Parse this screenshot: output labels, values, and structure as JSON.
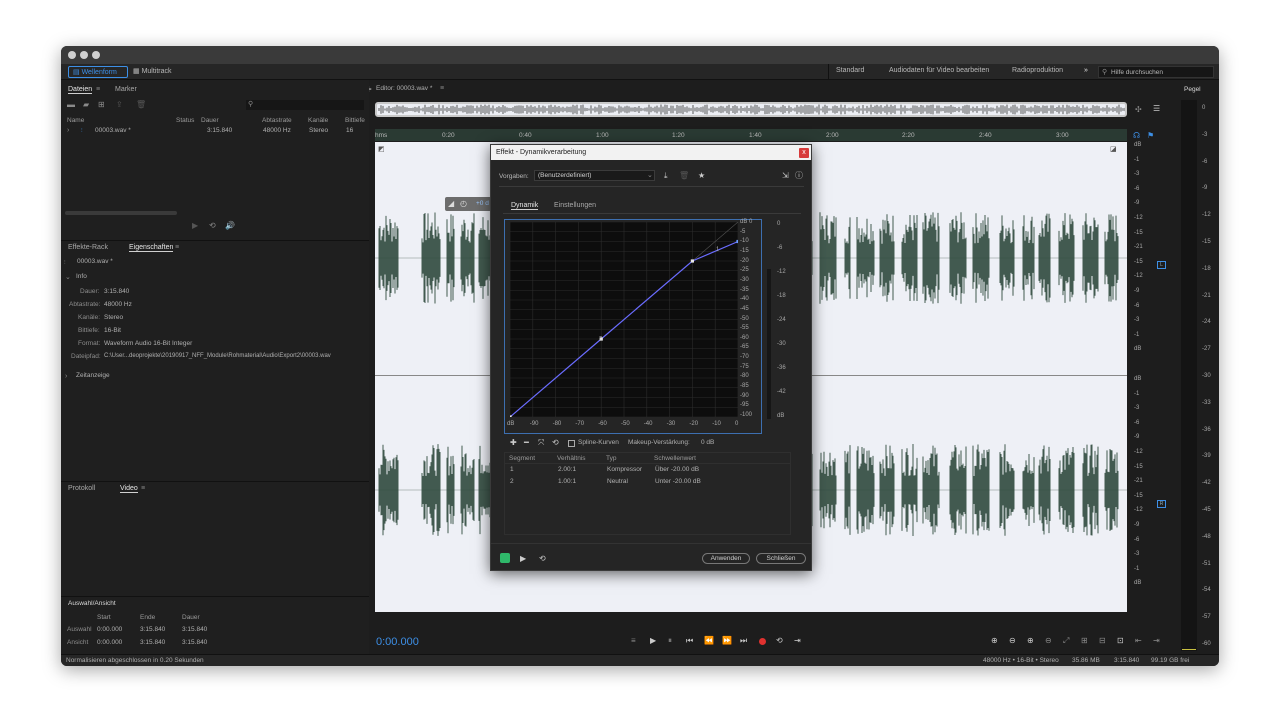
{
  "toolbar": {
    "waveform_label": "Wellenform",
    "multitrack_label": "Multitrack",
    "workspaces": [
      "Standard",
      "Audiodaten für Video bearbeiten",
      "Radioproduktion"
    ],
    "more_label": "»",
    "search_placeholder": "Hilfe durchsuchen"
  },
  "files_panel": {
    "tabs": [
      "Dateien",
      "Marker"
    ],
    "columns": [
      "Name",
      "Status",
      "Dauer",
      "Abtastrate",
      "Kanäle",
      "Bittiefe"
    ],
    "rows": [
      {
        "name": "00003.wav *",
        "status": "",
        "duration": "3:15.840",
        "rate": "48000 Hz",
        "channels": "Stereo",
        "depth": "16"
      }
    ]
  },
  "properties_panel": {
    "tabs": [
      "Effekte-Rack",
      "Eigenschaften"
    ],
    "file_name": "00003.wav *",
    "info_label": "Info",
    "info": [
      {
        "label": "Dauer:",
        "value": "3:15.840"
      },
      {
        "label": "Abtastrate:",
        "value": "48000 Hz"
      },
      {
        "label": "Kanäle:",
        "value": "Stereo"
      },
      {
        "label": "Bittiefe:",
        "value": "16-Bit"
      },
      {
        "label": "Format:",
        "value": "Waveform Audio 16-Bit Integer"
      },
      {
        "label": "Dateipfad:",
        "value": "C:\\User...deoprojekte\\20190917_NFF_Module\\Rohmaterial\\Audio\\Export2\\00003.wav"
      }
    ],
    "timecode_label": "Zeitanzeige"
  },
  "bottom_tabs": [
    "Protokoll",
    "Video"
  ],
  "selection_panel": {
    "title": "Auswahl/Ansicht",
    "columns": [
      "Start",
      "Ende",
      "Dauer"
    ],
    "rows": [
      {
        "label": "Auswahl",
        "start": "0:00.000",
        "end": "3:15.840",
        "dur": "3:15.840"
      },
      {
        "label": "Ansicht",
        "start": "0:00.000",
        "end": "3:15.840",
        "dur": "3:15.840"
      }
    ]
  },
  "editor": {
    "title": "Editor: 00003.wav *",
    "ruler": [
      "hms",
      "0:20",
      "0:40",
      "1:00",
      "1:20",
      "1:40",
      "2:00",
      "2:20",
      "2:40",
      "3:00"
    ],
    "db_scale": [
      "dB",
      "-1",
      "-3",
      "-6",
      "-9",
      "-12",
      "-15",
      "-21",
      "-15",
      "-12",
      "-9",
      "-6",
      "-3",
      "-1",
      "dB"
    ],
    "channel_l": "L",
    "channel_r": "R",
    "time_display": "0:00.000",
    "hud_value": "+0 d"
  },
  "level_panel": {
    "title": "Pegel",
    "scale": [
      "0",
      "-3",
      "-6",
      "-9",
      "-12",
      "-15",
      "-18",
      "-21",
      "-24",
      "-27",
      "-30",
      "-33",
      "-36",
      "-39",
      "-42",
      "-45",
      "-48",
      "-51",
      "-54",
      "-57",
      "-60"
    ]
  },
  "dialog": {
    "title": "Effekt - Dynamikverarbeitung",
    "close_label": "x",
    "preset_label": "Vorgaben:",
    "preset_value": "(Benutzerdefiniert)",
    "tabs": [
      "Dynamik",
      "Einstellungen"
    ],
    "graph_y_labels": [
      "dB 0",
      "-5",
      "-10",
      "-15",
      "-20",
      "-25",
      "-30",
      "-35",
      "-40",
      "-45",
      "-50",
      "-55",
      "-60",
      "-65",
      "-70",
      "-75",
      "-80",
      "-85",
      "-90",
      "-95",
      "-100"
    ],
    "graph_x_labels": [
      "dB",
      "-90",
      "-80",
      "-70",
      "-60",
      "-50",
      "-40",
      "-30",
      "-20",
      "-10",
      "0"
    ],
    "meter_labels": [
      "0",
      "-6",
      "-12",
      "-18",
      "-24",
      "-30",
      "-36",
      "-42",
      "dB"
    ],
    "point_labels": [
      "1",
      "2"
    ],
    "spline_label": "Spline-Kurven",
    "makeup_label": "Makeup-Verstärkung:",
    "makeup_value": "0 dB",
    "table_columns": [
      "Segment",
      "Verhältnis",
      "Typ",
      "Schwellenwert"
    ],
    "segments": [
      {
        "segment": "1",
        "ratio": "2.00:1",
        "type": "Kompressor",
        "threshold": "Über -20.00 dB"
      },
      {
        "segment": "2",
        "ratio": "1.00:1",
        "type": "Neutral",
        "threshold": "Unter -20.00 dB"
      }
    ],
    "apply_label": "Anwenden",
    "close_button_label": "Schließen"
  },
  "status_bar": {
    "message": "Normalisieren abgeschlossen in 0.20 Sekunden",
    "format": "48000 Hz • 16-Bit • Stereo",
    "size": "35.86 MB",
    "duration": "3:15.840",
    "free": "99.19 GB frei"
  },
  "colors": {
    "accent": "#3d8fe6",
    "waveform": "#2f4a3e",
    "wave_bg": "#eef0f6",
    "record": "#e0312f",
    "curve": "#6a6cff"
  }
}
